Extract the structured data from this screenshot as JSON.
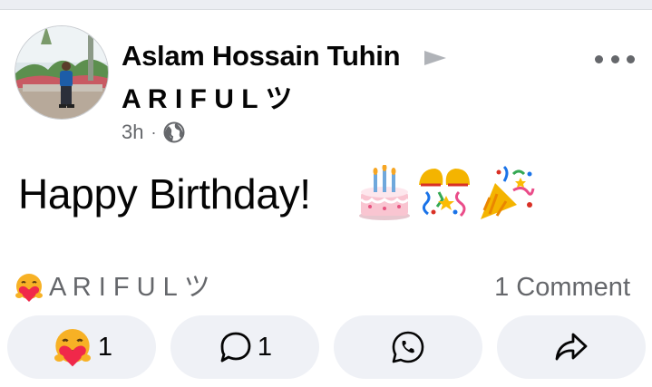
{
  "post": {
    "author": "Aslam Hossain Tuhin",
    "subtitle": "A R I F U L ツ",
    "time": "3h",
    "visibility_icon": "globe-icon",
    "text": "Happy Birthday!",
    "emojis": [
      "birthday-cake",
      "confetti-ball",
      "party-popper"
    ]
  },
  "reactions": {
    "reactor_label": "A R I F U L ツ",
    "reaction_type": "care",
    "comments_label": "1 Comment"
  },
  "actions": {
    "react_count": "1",
    "comment_count": "1",
    "whatsapp_icon": "whatsapp-icon",
    "share_icon": "share-icon"
  },
  "colors": {
    "secondary_text": "#65676b",
    "button_bg": "#eff1f6",
    "care_face": "#f7b125",
    "care_heart": "#f0284a"
  }
}
